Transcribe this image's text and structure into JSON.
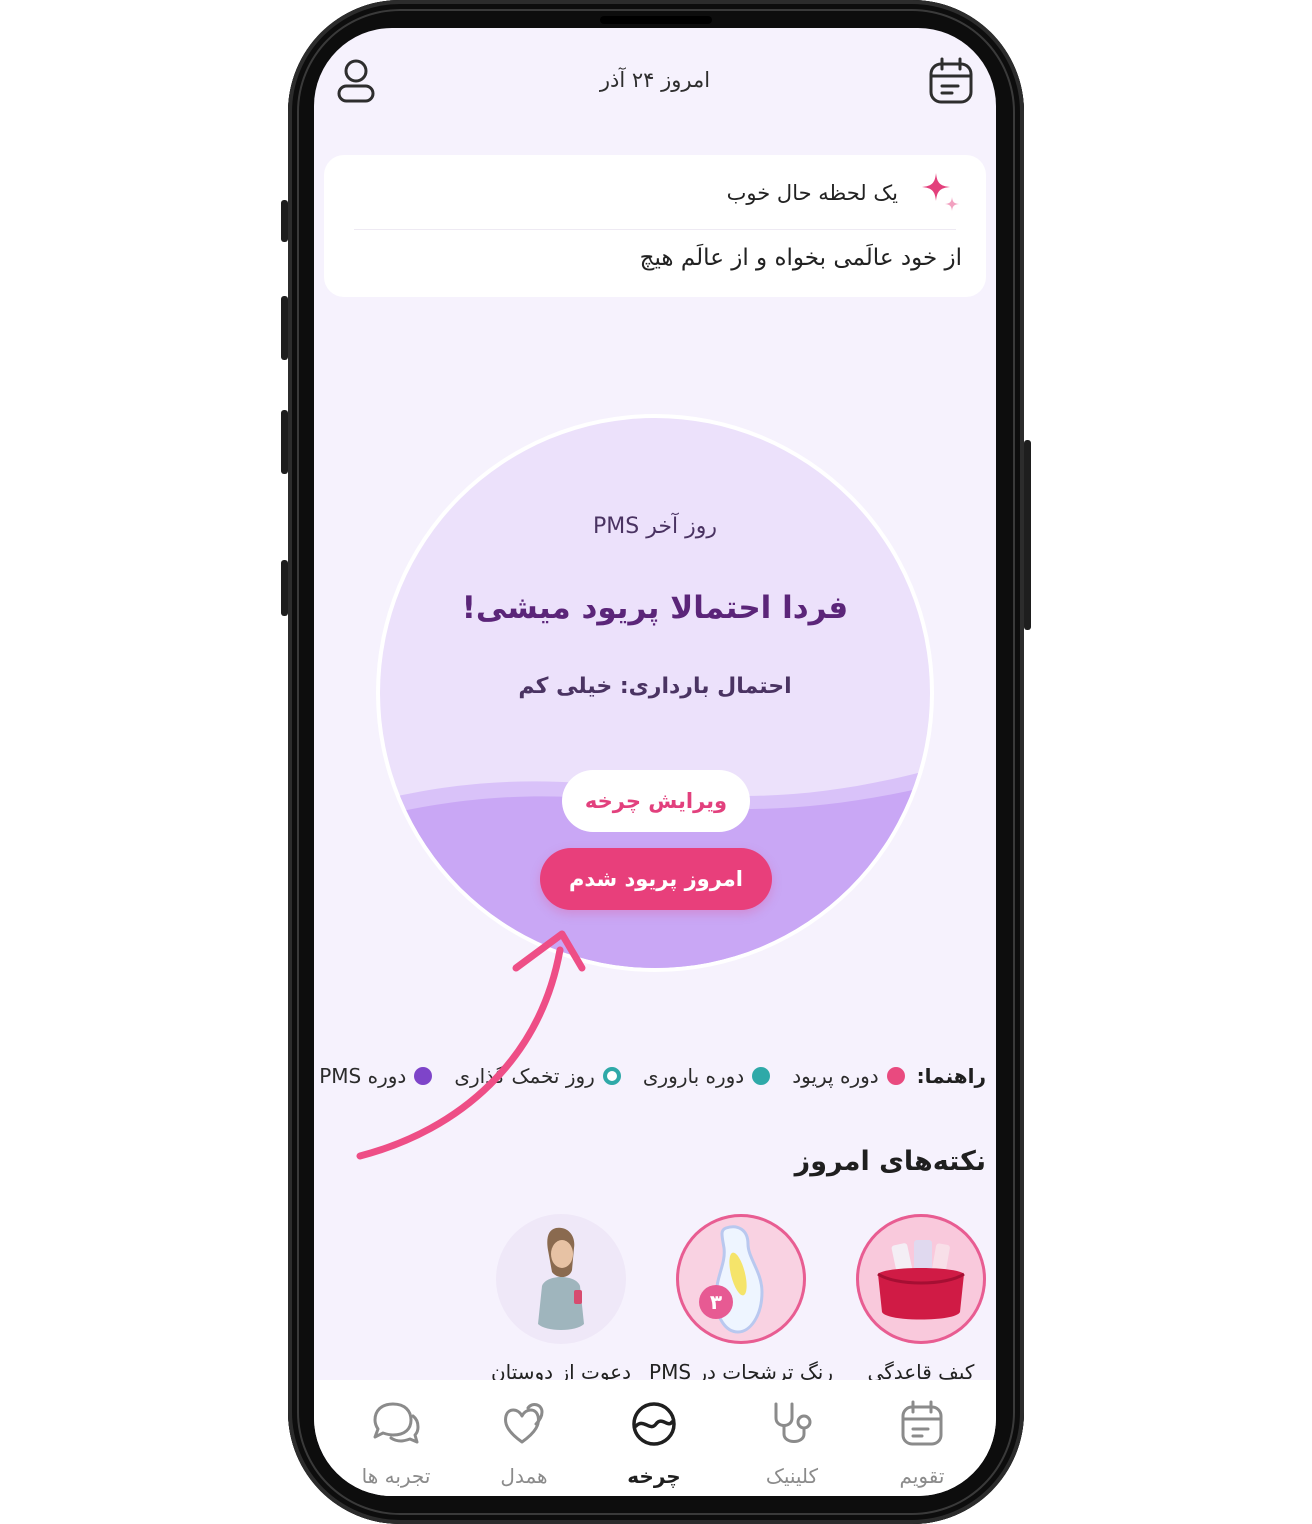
{
  "header": {
    "date": "امروز ۲۴ آذر",
    "profile_icon": "user-icon",
    "calendar_icon": "calendar-icon"
  },
  "mood_card": {
    "title": "یک لحظه حال خوب",
    "quote": "از خود عالَمی بخواه و از عالَم هیچ",
    "icon": "sparkle-icon"
  },
  "cycle": {
    "phase": "روز آخر PMS",
    "headline": "فردا احتمالا پریود میشی!",
    "pregnancy_chance": "احتمال بارداری: خیلی کم",
    "edit_button": "ویرایش چرخه",
    "period_button": "امروز پریود شدم"
  },
  "legend": {
    "label": "راهنما:",
    "items": [
      {
        "text": "دوره پریود",
        "color": "#e94a7f"
      },
      {
        "text": "دوره باروری",
        "color": "#2fa9a8"
      },
      {
        "text": "روز تخمک گذاری",
        "color": "#2fa9a8"
      },
      {
        "text": "دوره PMS",
        "color": "#7e44c9"
      }
    ]
  },
  "tips": {
    "title": "نکته‌های امروز",
    "items": [
      {
        "label": "کیف قاعدگی",
        "icon": "bag-icon"
      },
      {
        "label": "رنگ ترشحات در PMS",
        "icon": "pad-icon",
        "badge": "۳"
      },
      {
        "label": "دعوت از دوستان",
        "icon": "girl-phone-icon"
      }
    ]
  },
  "nav": {
    "items": [
      {
        "label": "تقویم",
        "icon": "calendar-icon"
      },
      {
        "label": "کلینیک",
        "icon": "stethoscope-icon"
      },
      {
        "label": "چرخه",
        "icon": "cycle-icon",
        "active": true
      },
      {
        "label": "همدل",
        "icon": "hearts-icon"
      },
      {
        "label": "تجربه ها",
        "icon": "chat-icon"
      }
    ]
  },
  "colors": {
    "accent": "#e83f7b",
    "screen_bg": "#f6f2fd",
    "circle_light": "#ece1fb",
    "circle_wave": "#c9a7f5",
    "headline": "#5b2579"
  }
}
